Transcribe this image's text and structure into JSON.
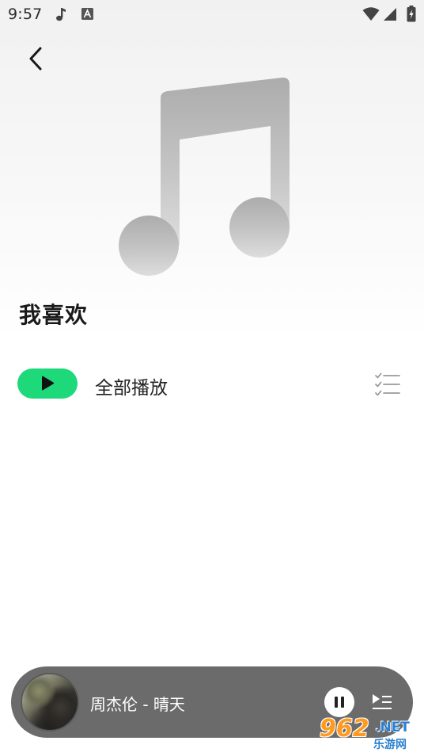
{
  "status_bar": {
    "time": "9:57",
    "icons": [
      "music-note-icon",
      "a-box-icon",
      "wifi-icon",
      "cell-signal-icon",
      "battery-charging-icon"
    ]
  },
  "header": {
    "back_icon": "chevron-left-icon"
  },
  "hero": {
    "icon": "music-note-icon"
  },
  "playlist": {
    "title": "我喜欢"
  },
  "controls": {
    "play_all_label": "全部播放",
    "play_icon": "play-icon",
    "multi_select_icon": "checklist-icon",
    "accent_color": "#1ed97a"
  },
  "mini_player": {
    "now_playing": "周杰伦 - 晴天",
    "pause_icon": "pause-icon",
    "queue_icon": "playlist-queue-icon"
  },
  "watermark": {
    "number": "962",
    "suffix": ".NET",
    "site_name": "乐游网"
  }
}
